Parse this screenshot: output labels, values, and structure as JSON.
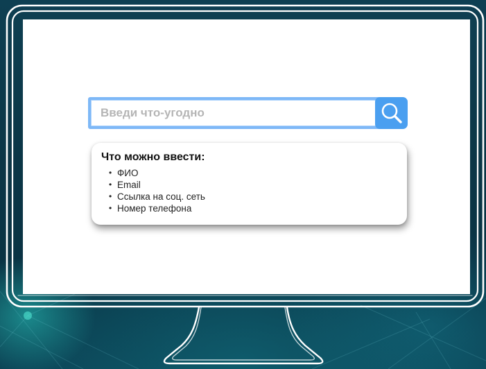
{
  "search": {
    "placeholder": "Введи что-угодно",
    "button_icon": "search-icon",
    "accent_color": "#4a9ff0",
    "border_color": "#7eb8f7"
  },
  "hint": {
    "title": "Что можно ввести:",
    "items": [
      {
        "label": "ФИО"
      },
      {
        "label": "Email"
      },
      {
        "label": "Ссылка на соц. сеть"
      },
      {
        "label": "Номер телефона"
      }
    ]
  },
  "icons": {
    "monitor": "monitor-icon",
    "search": "search-icon"
  },
  "colors": {
    "background": "#0b3646",
    "screen": "#ffffff",
    "monitor_outline": "#ffffff"
  }
}
